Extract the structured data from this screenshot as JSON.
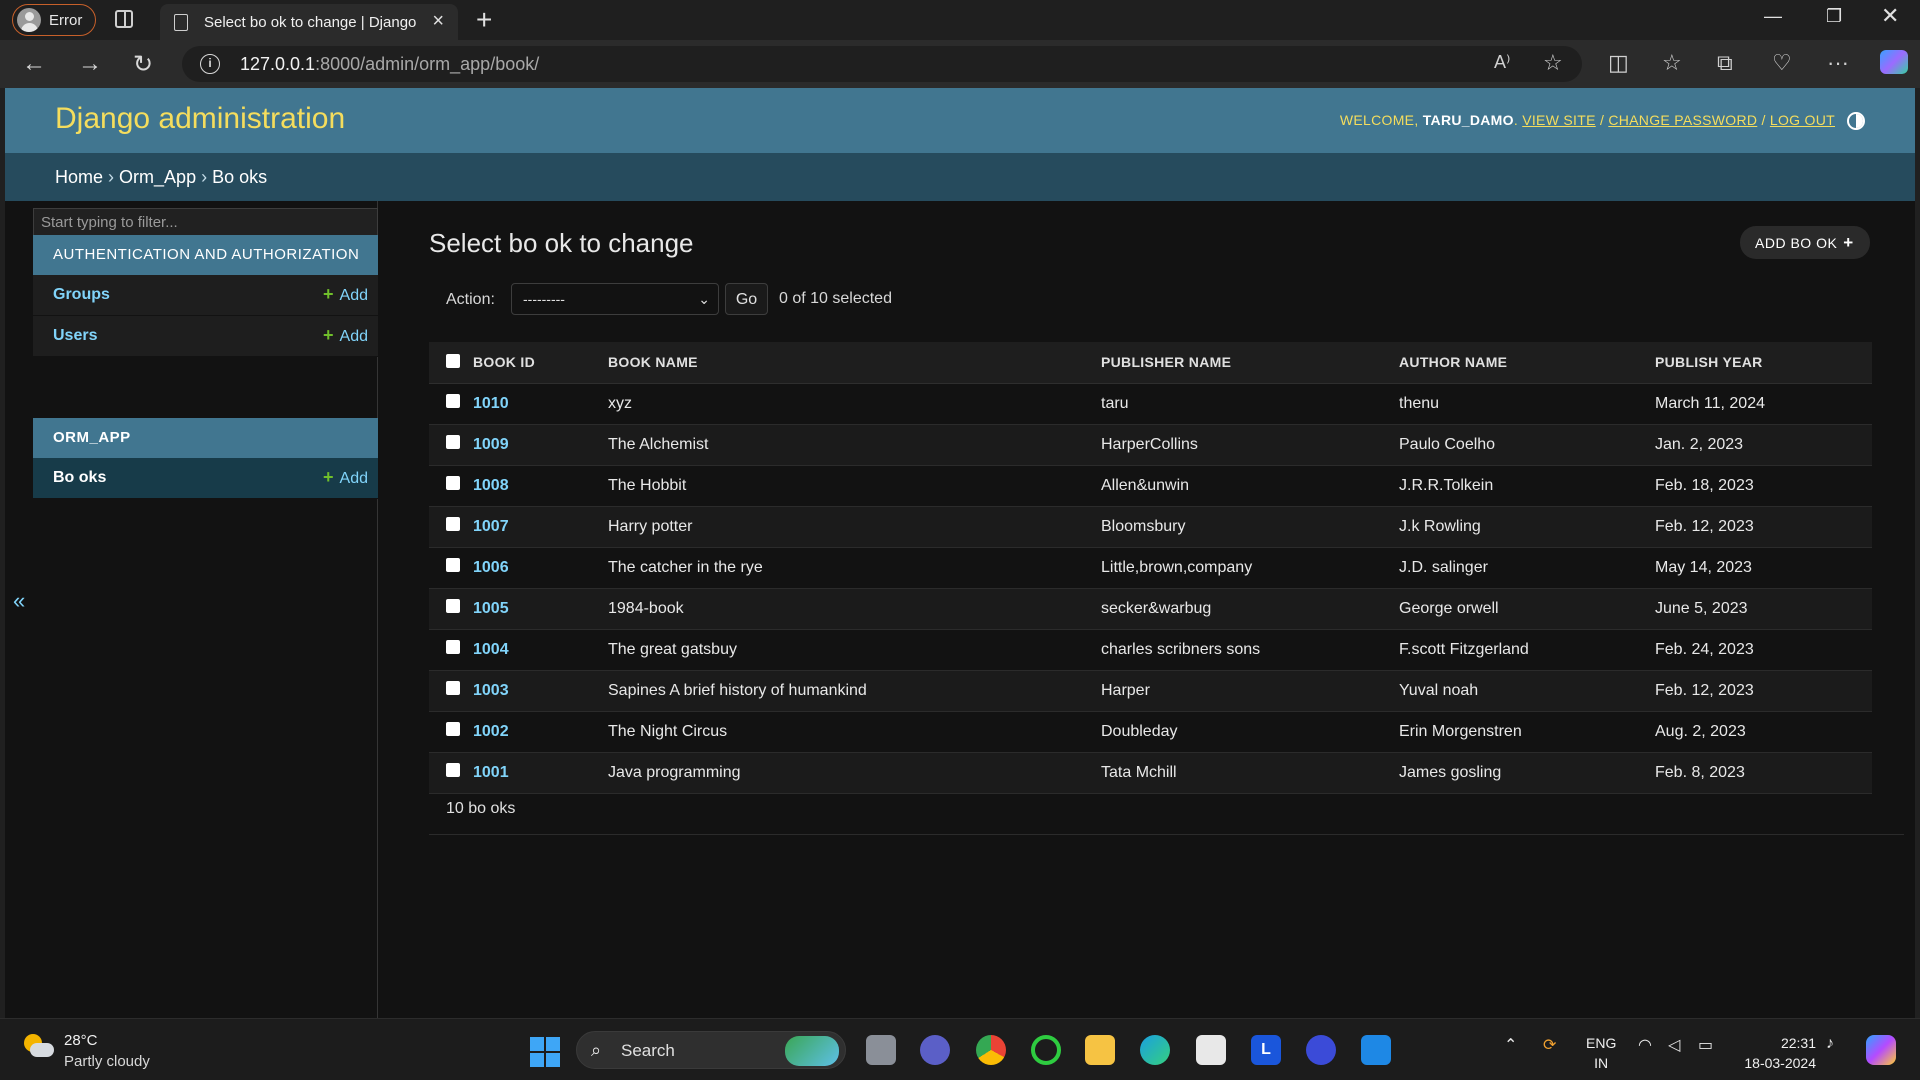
{
  "browser": {
    "profile_label": "Error",
    "tab_title": "Select bo ok to change | Django site admin",
    "url_host": "127.0.0.1",
    "url_path": ":8000/admin/orm_app/book/"
  },
  "header": {
    "brand": "Django administration",
    "welcome": "WELCOME,",
    "username": "TARU_DAMO",
    "view_site": "VIEW SITE",
    "change_password": "CHANGE PASSWORD",
    "log_out": "LOG OUT",
    "sep": "/"
  },
  "breadcrumbs": {
    "home": "Home",
    "app": "Orm_App",
    "model": "Bo oks",
    "sep": "›"
  },
  "sidebar": {
    "filter_placeholder": "Start typing to filter...",
    "modules": [
      {
        "caption": "AUTHENTICATION AND AUTHORIZATION",
        "rows": [
          {
            "name": "Groups",
            "add": "Add"
          },
          {
            "name": "Users",
            "add": "Add"
          }
        ]
      },
      {
        "caption": "ORM_APP",
        "rows": [
          {
            "name": "Bo oks",
            "add": "Add"
          }
        ]
      }
    ],
    "collapse_glyph": "«"
  },
  "content": {
    "title": "Select bo ok to change",
    "add_button": "ADD BO OK",
    "action_label": "Action:",
    "action_value": "---------",
    "go_label": "Go",
    "selected_count": "0 of 10 selected",
    "columns": [
      "BOOK ID",
      "BOOK NAME",
      "PUBLISHER NAME",
      "AUTHOR NAME",
      "PUBLISH YEAR"
    ],
    "rows": [
      {
        "id": "1010",
        "name": "xyz",
        "publisher": "taru",
        "author": "thenu",
        "year": "March 11, 2024"
      },
      {
        "id": "1009",
        "name": "The Alchemist",
        "publisher": "HarperCollins",
        "author": "Paulo Coelho",
        "year": "Jan. 2, 2023"
      },
      {
        "id": "1008",
        "name": "The Hobbit",
        "publisher": "Allen&unwin",
        "author": "J.R.R.Tolkein",
        "year": "Feb. 18, 2023"
      },
      {
        "id": "1007",
        "name": "Harry potter",
        "publisher": "Bloomsbury",
        "author": "J.k Rowling",
        "year": "Feb. 12, 2023"
      },
      {
        "id": "1006",
        "name": "The catcher in the rye",
        "publisher": "Little,brown,company",
        "author": "J.D. salinger",
        "year": "May 14, 2023"
      },
      {
        "id": "1005",
        "name": "1984-book",
        "publisher": "secker&warbug",
        "author": "George orwell",
        "year": "June 5, 2023"
      },
      {
        "id": "1004",
        "name": "The great gatsbuy",
        "publisher": "charles scribners sons",
        "author": "F.scott Fitzgerland",
        "year": "Feb. 24, 2023"
      },
      {
        "id": "1003",
        "name": "Sapines A brief history of humankind",
        "publisher": "Harper",
        "author": "Yuval noah",
        "year": "Feb. 12, 2023"
      },
      {
        "id": "1002",
        "name": "The Night Circus",
        "publisher": "Doubleday",
        "author": "Erin Morgenstren",
        "year": "Aug. 2, 2023"
      },
      {
        "id": "1001",
        "name": "Java programming",
        "publisher": "Tata Mchill",
        "author": "James gosling",
        "year": "Feb. 8, 2023"
      }
    ],
    "result_count": "10 bo oks"
  },
  "taskbar": {
    "temperature": "28°C",
    "condition": "Partly cloudy",
    "search_label": "Search",
    "lang_top": "ENG",
    "lang_bottom": "IN",
    "time": "22:31",
    "date": "18-03-2024"
  },
  "colors": {
    "header_bg": "#417690",
    "breadcrumb_bg": "#264b5d",
    "brand_yellow": "#f5dd5d",
    "link_blue": "#81d4fa",
    "add_green": "#70bf2b"
  }
}
